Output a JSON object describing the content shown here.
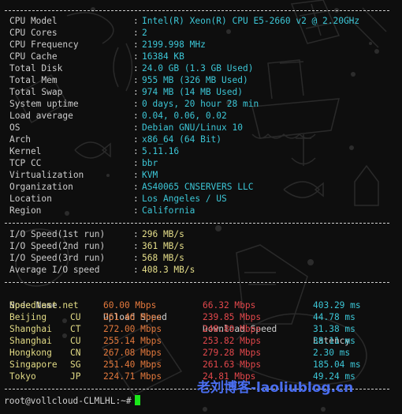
{
  "system_info": [
    {
      "label": "CPU Model",
      "value": "Intel(R) Xeon(R) CPU E5-2660 v2 @ 2.20GHz"
    },
    {
      "label": "CPU Cores",
      "value": "2"
    },
    {
      "label": "CPU Frequency",
      "value": "2199.998 MHz"
    },
    {
      "label": "CPU Cache",
      "value": "16384 KB"
    },
    {
      "label": "Total Disk",
      "value": "24.0 GB (1.3 GB Used)"
    },
    {
      "label": "Total Mem",
      "value": "955 MB (326 MB Used)"
    },
    {
      "label": "Total Swap",
      "value": "974 MB (14 MB Used)"
    },
    {
      "label": "System uptime",
      "value": "0 days, 20 hour 28 min"
    },
    {
      "label": "Load average",
      "value": "0.04, 0.06, 0.02"
    },
    {
      "label": "OS",
      "value": "Debian GNU/Linux 10"
    },
    {
      "label": "Arch",
      "value": "x86_64 (64 Bit)"
    },
    {
      "label": "Kernel",
      "value": "5.11.16"
    },
    {
      "label": "TCP CC",
      "value": "bbr"
    },
    {
      "label": "Virtualization",
      "value": "KVM"
    },
    {
      "label": "Organization",
      "value": "AS40065 CNSERVERS LLC"
    },
    {
      "label": "Location",
      "value": "Los Angeles / US"
    },
    {
      "label": "Region",
      "value": "California"
    }
  ],
  "io_speed": [
    {
      "label": "I/O Speed(1st run)",
      "value": "296 MB/s"
    },
    {
      "label": "I/O Speed(2nd run)",
      "value": "361 MB/s"
    },
    {
      "label": "I/O Speed(3rd run)",
      "value": "568 MB/s"
    },
    {
      "label": "Average I/O speed",
      "value": "408.3 MB/s"
    }
  ],
  "colon": ":",
  "speedtest": {
    "headers": {
      "node": "Node Name",
      "upload": "Upload Speed",
      "download": "Download Speed",
      "latency": "Latency"
    },
    "rows": [
      {
        "node": "Speedtest.net",
        "cc": "",
        "upload": "60.00 Mbps",
        "download": "66.32 Mbps",
        "latency": "403.29 ms"
      },
      {
        "node": "Beijing",
        "cc": "CU",
        "upload": "261.46 Mbps",
        "download": "239.85 Mbps",
        "latency": "44.78 ms"
      },
      {
        "node": "Shanghai",
        "cc": "CT",
        "upload": "272.00 Mbps",
        "download": "248.89 Mbps",
        "latency": "31.38 ms"
      },
      {
        "node": "Shanghai",
        "cc": "CU",
        "upload": "255.14 Mbps",
        "download": "253.82 Mbps",
        "latency": "38.11 ms"
      },
      {
        "node": "Hongkong",
        "cc": "CN",
        "upload": "267.08 Mbps",
        "download": "279.28 Mbps",
        "latency": "2.30 ms"
      },
      {
        "node": "Singapore",
        "cc": "SG",
        "upload": "251.40 Mbps",
        "download": "261.63 Mbps",
        "latency": "185.04 ms"
      },
      {
        "node": "Tokyo",
        "cc": "JP",
        "upload": "224.71 Mbps",
        "download": "24.81 Mbps",
        "latency": "49.24 ms"
      }
    ]
  },
  "prompt": "root@vollcloud-CLMLHL:~#",
  "watermark": "老刘博客-laoliublog.cn",
  "colors": {
    "background": "#0e0e0e",
    "label": "#cccccc",
    "value_cyan": "#3cc6d6",
    "io_yellow": "#e6df8a",
    "upload_orange": "#e4793c",
    "download_red": "#e2474b",
    "cursor_green": "#19e619",
    "watermark_blue": "#4a6ef0"
  }
}
